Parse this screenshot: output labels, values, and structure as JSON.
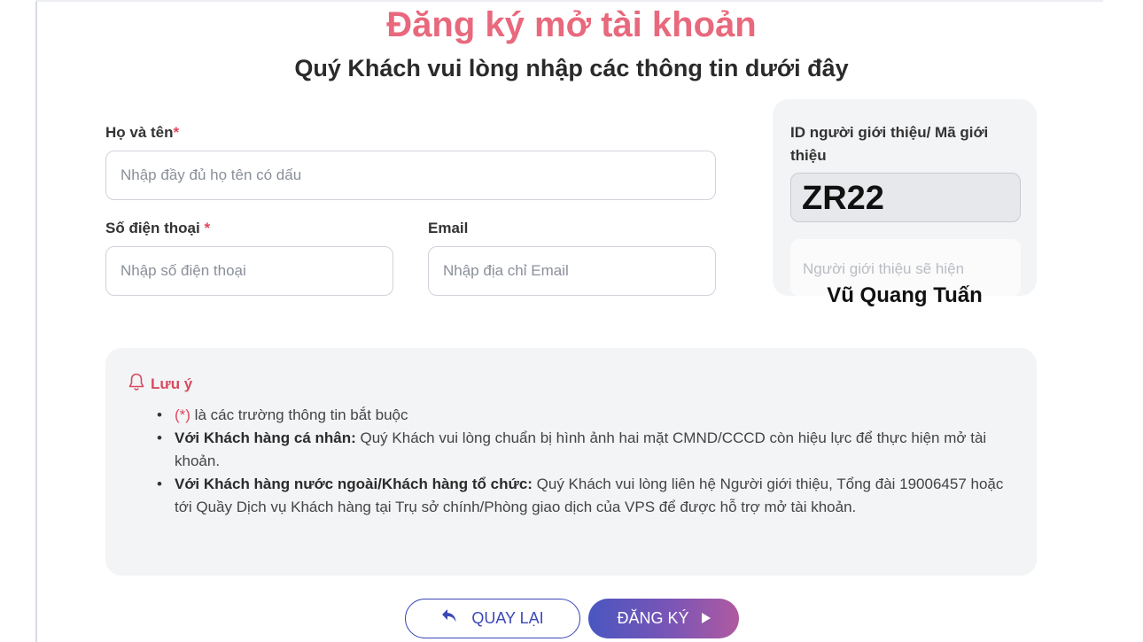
{
  "page": {
    "title": "Đăng ký mở tài khoản",
    "subtitle": "Quý Khách vui lòng nhập các thông tin dưới đây"
  },
  "form": {
    "full_name": {
      "label": "Họ và tên",
      "required_mark": "*",
      "placeholder": "Nhập đầy đủ họ tên có dấu",
      "value": ""
    },
    "phone": {
      "label": "Số điện thoại",
      "required_mark": "*",
      "placeholder": "Nhập số điện thoại",
      "value": ""
    },
    "email": {
      "label": "Email",
      "placeholder": "Nhập địa chỉ Email",
      "value": ""
    }
  },
  "referrer": {
    "label": "ID người giới thiệu/ Mã giới thiệu",
    "code": "ZR22",
    "name_placeholder": "Người giới thiệu sẽ hiện",
    "name": "Vũ Quang Tuấn"
  },
  "note": {
    "title": "Lưu ý",
    "items": [
      {
        "prefix": "(*)",
        "bold": "",
        "text": " là các trường thông tin bắt buộc"
      },
      {
        "prefix": "",
        "bold": "Với Khách hàng cá nhân:",
        "text": " Quý Khách vui lòng chuẩn bị hình ảnh hai mặt CMND/CCCD còn hiệu lực để thực hiện mở tài khoản."
      },
      {
        "prefix": "",
        "bold": "Với Khách hàng nước ngoài/Khách hàng tổ chức:",
        "text": " Quý Khách vui lòng liên hệ Người giới thiệu, Tổng đài 19006457 hoặc tới Quầy Dịch vụ Khách hàng tại Trụ sở chính/Phòng giao dịch của VPS để được hỗ trợ mở tài khoản."
      }
    ]
  },
  "actions": {
    "back_label": "QUAY LẠI",
    "register_label": "ĐĂNG KÝ"
  },
  "icons": {
    "note": "bell-icon",
    "back": "reply-arrow-icon",
    "register": "play-triangle-icon"
  },
  "colors": {
    "title": "#e8697d",
    "accent": "#3b49b8",
    "required": "#e0475e"
  }
}
